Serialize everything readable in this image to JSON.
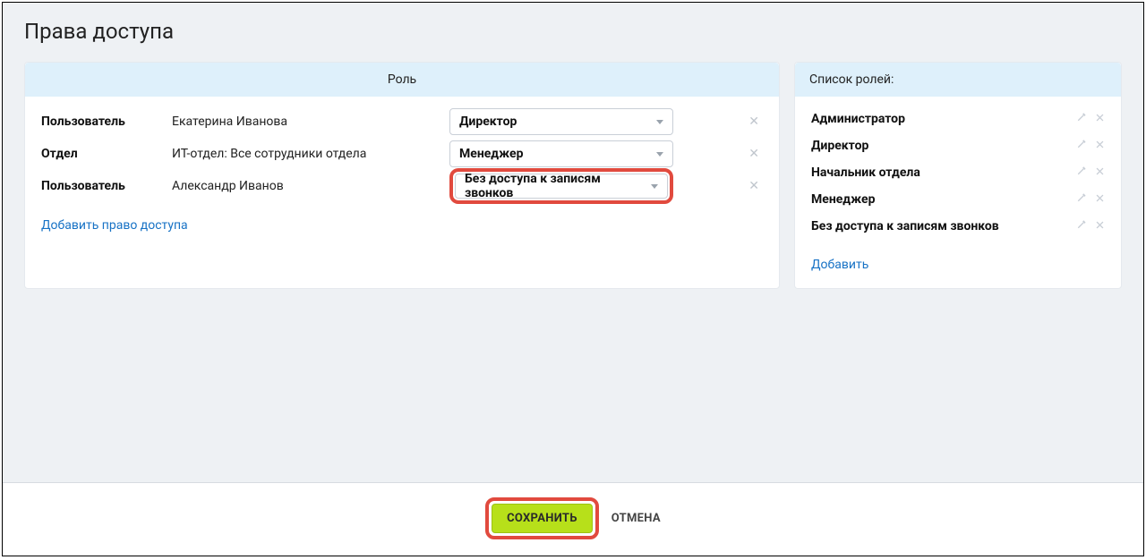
{
  "page_title": "Права доступа",
  "main": {
    "header": "Роль",
    "rows": [
      {
        "type": "Пользователь",
        "subject": "Екатерина Иванова",
        "role": "Директор",
        "highlighted": false
      },
      {
        "type": "Отдел",
        "subject": "ИТ-отдел: Все сотрудники отдела",
        "role": "Менеджер",
        "highlighted": false
      },
      {
        "type": "Пользователь",
        "subject": "Александр Иванов",
        "role": "Без доступа к записям звонков",
        "highlighted": true
      }
    ],
    "add_link": "Добавить право доступа"
  },
  "side": {
    "header": "Список ролей:",
    "roles": [
      "Администратор",
      "Директор",
      "Начальник отдела",
      "Менеджер",
      "Без доступа к записям звонков"
    ],
    "add_link": "Добавить"
  },
  "footer": {
    "save": "СОХРАНИТЬ",
    "cancel": "ОТМЕНА"
  }
}
